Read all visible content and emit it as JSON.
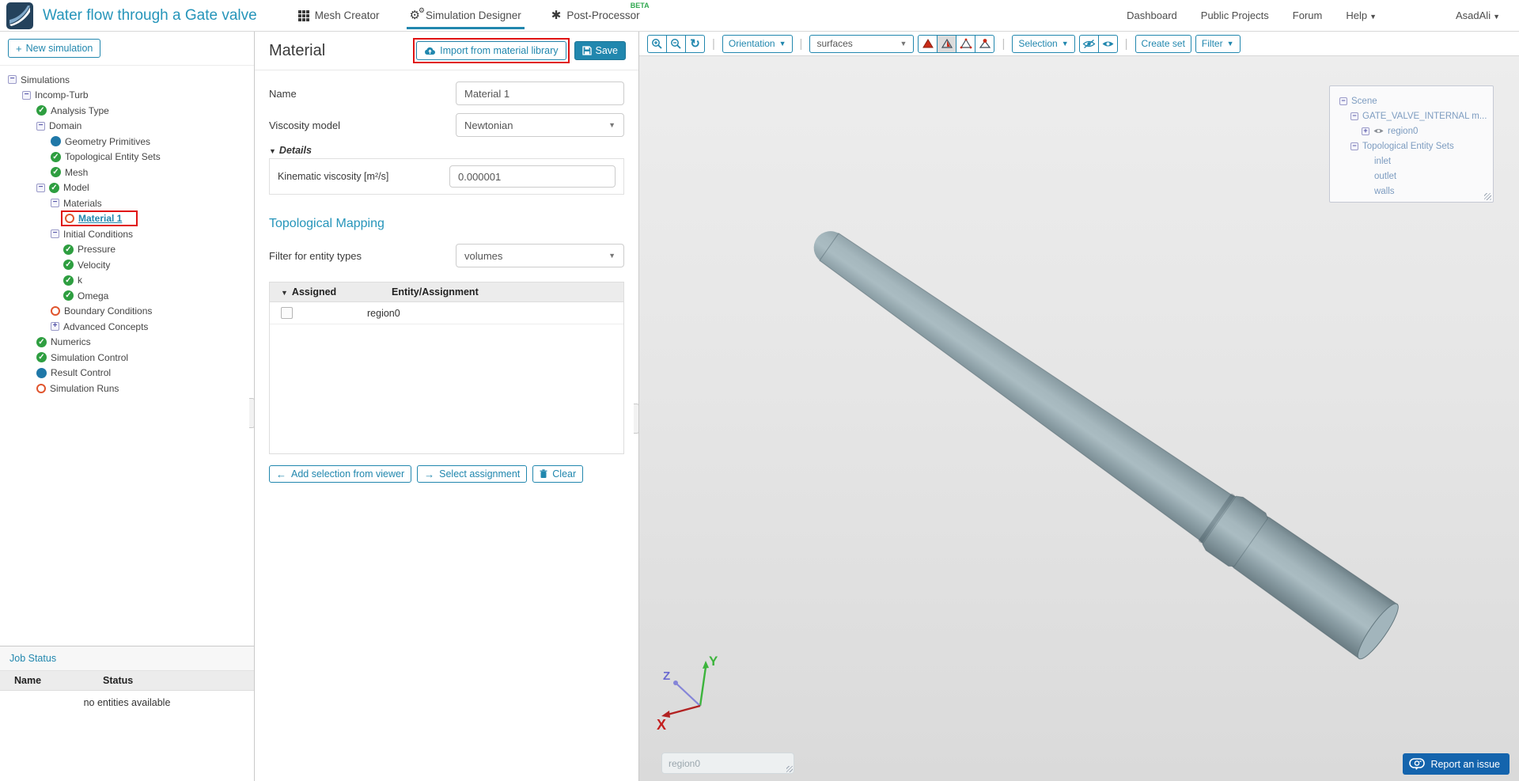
{
  "colors": {
    "accent": "#2187ae",
    "title_blue": "#2695ba",
    "highlight_red": "#e01313",
    "status_green": "#2e9e40",
    "status_blue": "#1f78a8",
    "status_orange": "#e0552e",
    "report_blue": "#1464ad",
    "beta_green": "#2fa84f",
    "pipe_gray_blue": "#9fb2b8",
    "viewer_bg": "#e6e6e6"
  },
  "header": {
    "title": "Water flow through a Gate valve",
    "tabs": [
      {
        "label": "Mesh Creator"
      },
      {
        "label": "Simulation Designer"
      },
      {
        "label": "Post-Processor",
        "badge": "BETA"
      }
    ],
    "nav": [
      {
        "label": "Dashboard"
      },
      {
        "label": "Public Projects"
      },
      {
        "label": "Forum"
      },
      {
        "label": "Help"
      },
      {
        "label": "AsadAli"
      }
    ]
  },
  "sidebar": {
    "new_simulation": "New simulation",
    "tree": [
      {
        "label": "Simulations"
      },
      {
        "label": "Incomp-Turb"
      },
      {
        "label": "Analysis Type"
      },
      {
        "label": "Domain"
      },
      {
        "label": "Geometry Primitives"
      },
      {
        "label": "Topological Entity Sets"
      },
      {
        "label": "Mesh"
      },
      {
        "label": "Model"
      },
      {
        "label": "Materials"
      },
      {
        "label": "Material 1"
      },
      {
        "label": "Initial Conditions"
      },
      {
        "label": "Pressure"
      },
      {
        "label": "Velocity"
      },
      {
        "label": "k"
      },
      {
        "label": "Omega"
      },
      {
        "label": "Boundary Conditions"
      },
      {
        "label": "Advanced Concepts"
      },
      {
        "label": "Numerics"
      },
      {
        "label": "Simulation Control"
      },
      {
        "label": "Result Control"
      },
      {
        "label": "Simulation Runs"
      }
    ],
    "job_status": {
      "title": "Job Status",
      "col_name": "Name",
      "col_status": "Status",
      "empty_message": "no entities available"
    }
  },
  "material_panel": {
    "title": "Material",
    "import_button": "Import from material library",
    "save_button": "Save",
    "fields": {
      "name_label": "Name",
      "name_value": "Material 1",
      "viscosity_label": "Viscosity model",
      "viscosity_value": "Newtonian",
      "details_label": "Details",
      "kinematic_label": "Kinematic viscosity [m²/s]",
      "kinematic_value": "0.000001"
    },
    "topological_mapping": {
      "heading": "Topological Mapping",
      "filter_label": "Filter for entity types",
      "filter_value": "volumes",
      "table": {
        "col_assigned": "Assigned",
        "col_entity": "Entity/Assignment",
        "rows": [
          {
            "entity": "region0",
            "assigned": false
          }
        ]
      }
    },
    "actions": {
      "add": "Add selection from viewer",
      "select": "Select assignment",
      "clear": "Clear"
    }
  },
  "viewer": {
    "toolbar": {
      "orientation": "Orientation",
      "surfaces_value": "surfaces",
      "selection": "Selection",
      "create_set": "Create set",
      "filter": "Filter"
    },
    "scene_tree": [
      {
        "label": "Scene"
      },
      {
        "label": "GATE_VALVE_INTERNAL m..."
      },
      {
        "label": "region0"
      },
      {
        "label": "Topological Entity Sets"
      },
      {
        "label": "inlet"
      },
      {
        "label": "outlet"
      },
      {
        "label": "walls"
      }
    ],
    "axis": {
      "x": "X",
      "y": "Y",
      "z": "Z"
    },
    "region_placeholder": "region0",
    "report_button": "Report an issue"
  }
}
